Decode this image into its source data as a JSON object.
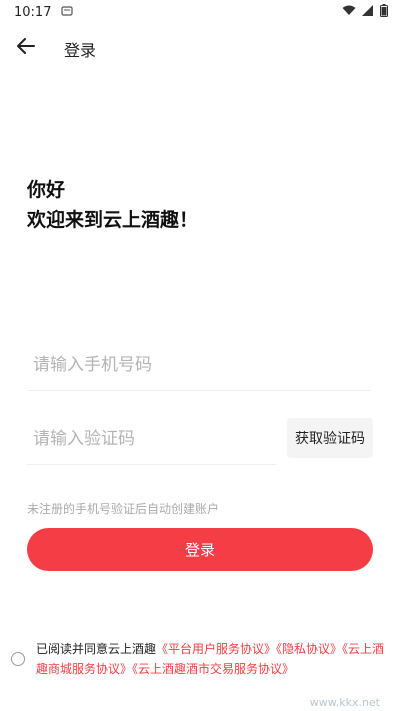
{
  "status_bar": {
    "time": "10:17"
  },
  "header": {
    "title": "登录"
  },
  "greeting": {
    "line1": "你好",
    "line2": "欢迎来到云上酒趣！"
  },
  "form": {
    "phone_placeholder": "请输入手机号码",
    "code_placeholder": "请输入验证码",
    "get_code_label": "获取验证码",
    "hint": "未注册的手机号验证后自动创建账户",
    "login_label": "登录"
  },
  "agreement": {
    "prefix": "已阅读并同意云上酒趣",
    "links": [
      "《平台用户服务协议》",
      "《隐私协议》",
      "《云上酒趣商城服务协议》",
      "《云上酒趣酒市交易服务协议》"
    ]
  },
  "watermark": "www.kkx.net",
  "colors": {
    "accent": "#f53d45"
  }
}
